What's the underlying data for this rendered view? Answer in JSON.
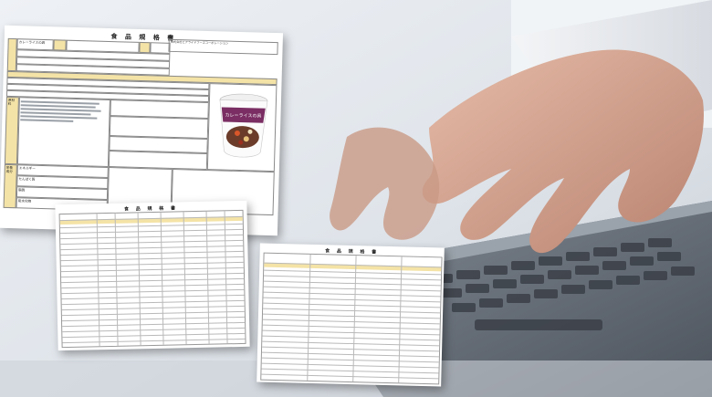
{
  "main_sheet": {
    "title": "食 品 規 格 書",
    "company": "株式会社ビアライドフーズコーポレーション",
    "product_label": "カレーライスの具",
    "product_section_label": "原材料",
    "nutrition_label": "栄養成分",
    "product_name_label": "商品名",
    "photo_label": "カップ入り食品 画像",
    "cup_label": "カレーライスの具",
    "nutrition_values": [
      "エネルギー",
      "たんぱく質",
      "脂質",
      "炭水化物"
    ]
  },
  "middle_sheet": {
    "title": "食 品 規 格 書"
  },
  "right_sheet": {
    "title": "食 品 規 格 書"
  },
  "colors": {
    "sheet_header": "#f4e3a6",
    "cup_wrap": "#7a2e63",
    "laptop_body": "#5f6670",
    "skin": "#d8a893"
  }
}
